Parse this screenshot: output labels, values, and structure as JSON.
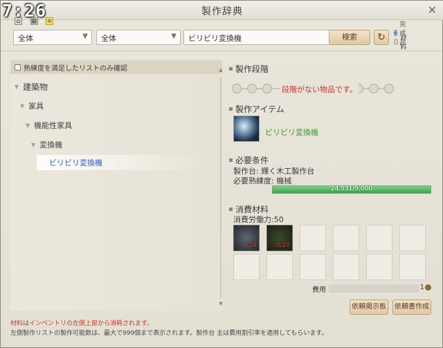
{
  "window": {
    "title": "製作辞典",
    "close_glyph": "✕",
    "clock": "7:26"
  },
  "mini_nav": {
    "icons": [
      "home-icon",
      "grid-icon",
      "list-icon"
    ],
    "separator": "<"
  },
  "toolbar": {
    "category1": "全体",
    "category2": "全体",
    "search_value": "ビリビリ変換機",
    "search_button": "検索",
    "refresh_icon": "refresh-icon",
    "radio_options": [
      {
        "label": "完成品",
        "selected": true
      },
      {
        "label": "材料",
        "selected": false
      }
    ]
  },
  "left": {
    "filter_label": "熟練度を満足したリストのみ確認",
    "tree": [
      {
        "label": "建築物",
        "level": 0
      },
      {
        "label": "家具",
        "level": 1
      },
      {
        "label": "機能性家具",
        "level": 2
      },
      {
        "label": "変換機",
        "level": 3
      },
      {
        "label": "ビリビリ変換機",
        "level": 4,
        "selected": true
      }
    ]
  },
  "right": {
    "steps_title": "製作段階",
    "steps_message": "段階がない物品です。",
    "item_title": "製作アイテム",
    "item_name": "ビリビリ変換機",
    "req_title": "必要条件",
    "req_station": "製作台: 輝く木工製作台",
    "req_skill": "必要熟練度: 機械",
    "progress_text": "24,531/5,000",
    "progress_fraction": 1.0,
    "mat_title": "消費材料",
    "labor": "消費労働力:50",
    "materials": [
      {
        "count": "0/4",
        "icon": "ore-icon"
      },
      {
        "count": "0/20",
        "icon": "leaf-icon"
      }
    ],
    "cost_label": "費用",
    "cost_value": "1",
    "buttons": {
      "request_board": "依頼掲示板",
      "create_request": "依頼書作成"
    }
  },
  "footer": {
    "line1": "材料はインベントリの左側上部から消耗されます。",
    "line2": "左側製作リストの製作可能数は、最大で999個まで表示されます。製作台 主は費用割引率を適用してもらいます。"
  },
  "colors": {
    "accent": "#2e5fa8",
    "warning": "#c0392b",
    "success": "#3ea150"
  }
}
